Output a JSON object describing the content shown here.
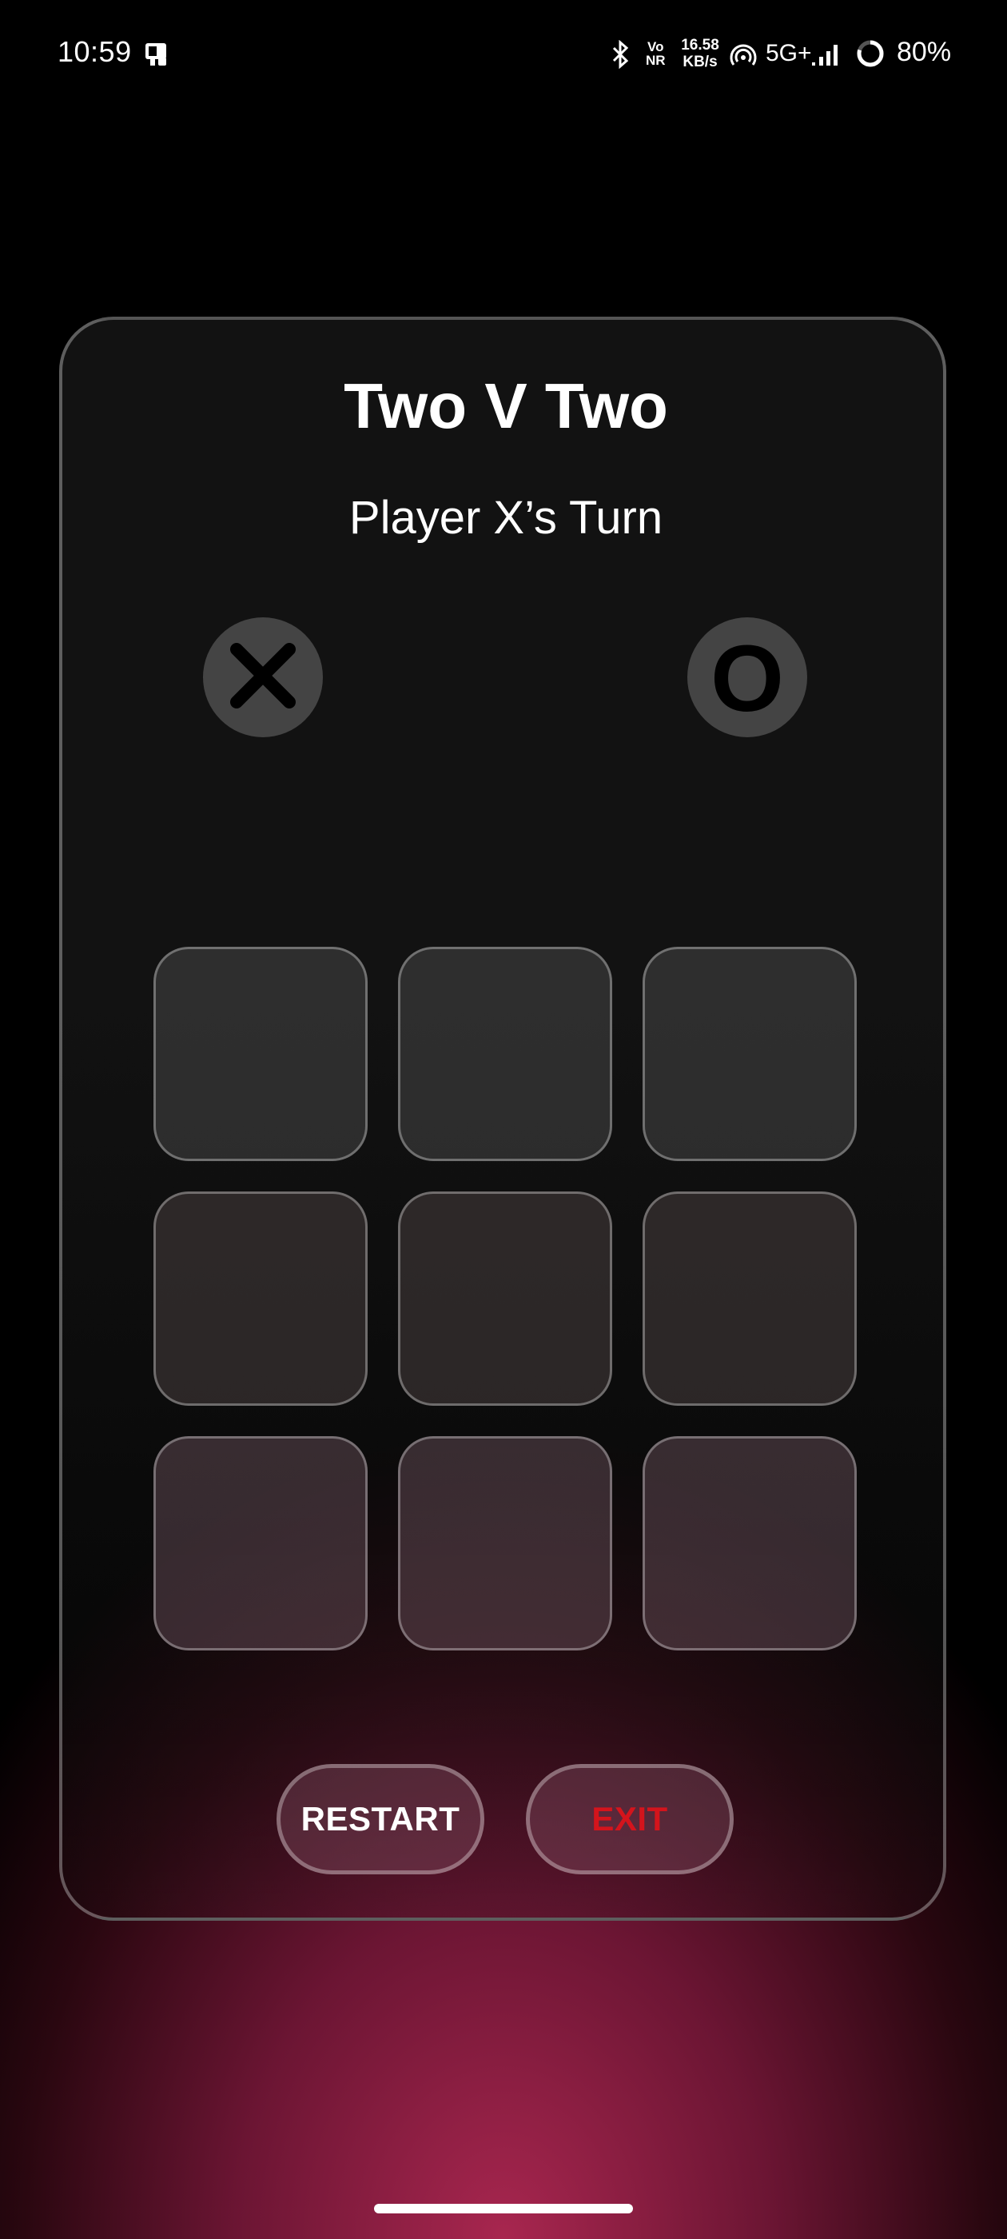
{
  "status_bar": {
    "time": "10:59",
    "network_speed_value": "16.58",
    "network_speed_unit": "KB/s",
    "vo_label_top": "Vo",
    "vo_label_bottom": "NR",
    "network_type": "5G+",
    "battery": "80%",
    "icons": [
      "screen-mirror-icon",
      "bluetooth-icon",
      "volte-icon",
      "hotspot-icon",
      "signal-icon",
      "battery-ring-icon"
    ]
  },
  "game": {
    "title": "Two V Two",
    "turn_text": "Player X’s Turn",
    "player_x_icon": "x-mark-icon",
    "player_o_letter": "O",
    "board": [
      [
        "",
        "",
        ""
      ],
      [
        "",
        "",
        ""
      ],
      [
        "",
        "",
        ""
      ]
    ]
  },
  "buttons": {
    "restart_label": "RESTART",
    "exit_label": "EXIT"
  },
  "colors": {
    "accent_bottom": "#a8264f",
    "exit_text": "#d4141c",
    "card_bg": "#121212",
    "badge_bg": "#444444"
  }
}
